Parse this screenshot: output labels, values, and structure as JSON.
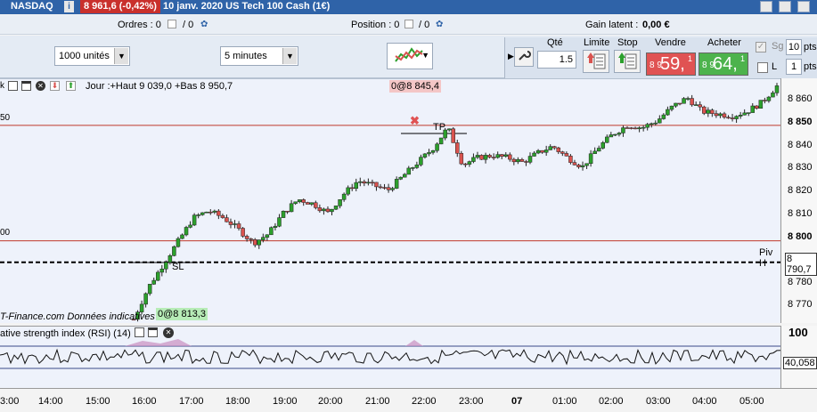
{
  "titlebar": {
    "symbol": "NASDAQ",
    "info_icon": "i",
    "price_change": "8 961,6 (-0,42%)",
    "description": "10 janv. 2020 US Tech 100 Cash (1€)"
  },
  "inforow": {
    "orders_label": "Ordres : 0",
    "orders_extra": "/ 0",
    "position_label": "Position : 0",
    "position_extra": "/ 0",
    "gain_label": "Gain latent :",
    "gain_value": "0,00 €"
  },
  "toolbar": {
    "units": "1000 unités",
    "timeframe": "5 minutes",
    "qty_label": "Qté",
    "qty_value": "1.5",
    "limit_label": "Limite",
    "stop_label": "Stop",
    "sell_label": "Vendre",
    "buy_label": "Acheter",
    "sell_small": "8 9",
    "sell_big": "59,",
    "sell_sup": "1",
    "buy_small": "8 9",
    "buy_big": "64,",
    "buy_sup": "1",
    "sg_label": "Sg",
    "l_label": "L",
    "pts1_value": "10",
    "pts2_value": "1",
    "pts_label": "pts"
  },
  "chart": {
    "header_text": "Jour :+Haut 9 039,0 +Bas 8 950,7",
    "top_badge": "0@8 845,4",
    "bottom_badge": "0@8 813,3",
    "tp_label": "TP",
    "sl_label": "SL",
    "piv_label": "Piv H",
    "left_label_1": "50",
    "left_label_2": "00",
    "watermark": "T-Finance.com  Données indicatives",
    "rsi_title": "ative strength index (RSI) (14)",
    "rsi_value": "40,058",
    "rsi_100": "100",
    "date_marker": "07",
    "y_ticks": [
      "8 860",
      "8 850",
      "8 840",
      "8 830",
      "8 820",
      "8 810",
      "8 800",
      "8 790,7",
      "8 780",
      "8 770"
    ],
    "x_ticks": [
      "3:00",
      "14:00",
      "15:00",
      "16:00",
      "17:00",
      "18:00",
      "19:00",
      "20:00",
      "21:00",
      "22:00",
      "23:00",
      "07",
      "01:00",
      "02:00",
      "03:00",
      "04:00",
      "05:00"
    ]
  },
  "chart_data": {
    "type": "candlestick",
    "y_range": [
      8764,
      8870
    ],
    "levels": [
      8850,
      8800
    ],
    "pivot": 8790.7,
    "close_path": [
      8766,
      8780,
      8790,
      8800,
      8810,
      8813,
      8810,
      8805,
      8799,
      8803,
      8812,
      8818,
      8816,
      8812,
      8820,
      8826,
      8824,
      8822,
      8828,
      8834,
      8840,
      8849,
      8833,
      8836,
      8837,
      8836,
      8834,
      8838,
      8841,
      8836,
      8832,
      8840,
      8846,
      8850,
      8849,
      8852,
      8858,
      8862,
      8856,
      8855,
      8854,
      8856,
      8860,
      8867
    ]
  },
  "colors": {
    "up": "#2ca02c",
    "down": "#d9534f",
    "sell_bg": "#e05353",
    "buy_bg": "#4db34d",
    "level_line": "#c0392b"
  }
}
